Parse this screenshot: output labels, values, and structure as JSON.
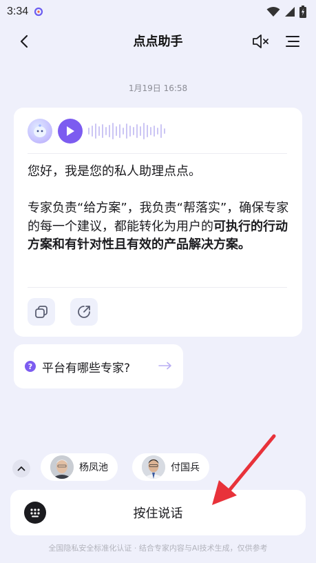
{
  "status_bar": {
    "time": "3:34",
    "icons": [
      "app-badge-icon",
      "wifi-icon",
      "signal-icon",
      "battery-icon"
    ]
  },
  "header": {
    "title": "点点助手",
    "icons": [
      "back-arrow-icon",
      "speaker-muted-icon",
      "menu-icon"
    ]
  },
  "chat": {
    "timestamp": "1月19日 16:58",
    "message": {
      "line1": "您好，我是您的私人助理点点。",
      "line2_normal": "专家负责“给方案”，我负责“帮落实”，确保专家的每一个建议，都能转化为用户的",
      "line2_bold": "可执行的行动方案和有针对性且有效的产品解决方案。"
    },
    "actions": [
      "copy-icon",
      "share-icon"
    ]
  },
  "suggestion": {
    "text": "平台有哪些专家?",
    "icon": "question-icon"
  },
  "experts": [
    {
      "name": "杨凤池"
    },
    {
      "name": "付国兵"
    }
  ],
  "input": {
    "voice_label": "按住说话",
    "keyboard_icon": "keyboard-icon"
  },
  "footer": {
    "text": "全国隐私安全标准化认证 · 结合专家内容与AI技术生成，仅供参考"
  },
  "colors": {
    "background": "#eff0fb",
    "accent": "#7c5cf0",
    "card": "#ffffff",
    "annotation_arrow": "#e8323a"
  }
}
